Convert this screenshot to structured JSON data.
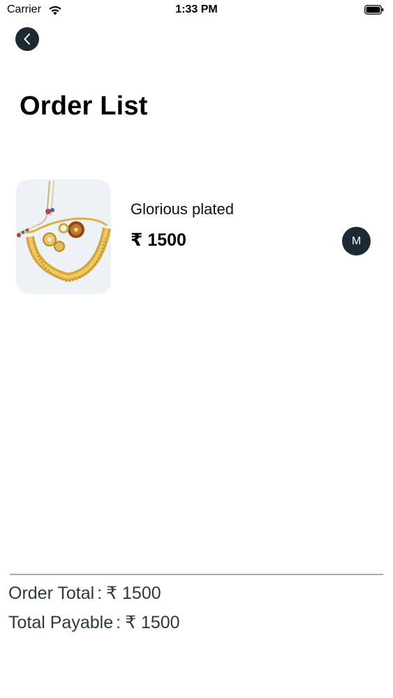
{
  "status_bar": {
    "carrier": "Carrier",
    "time": "1:33 PM",
    "icons": [
      "wifi-icon",
      "battery-icon"
    ]
  },
  "header": {
    "back_icon": "chevron-left-icon",
    "title": "Order List"
  },
  "orders": [
    {
      "name": "Glorious plated",
      "price": "₹ 1500",
      "avatar_initial": "M",
      "image": "gold-necklace-set"
    }
  ],
  "totals": {
    "order_total_label": "Order Total",
    "order_total_value": "₹ 1500",
    "payable_label": "Total Payable",
    "payable_value": "₹ 1500",
    "separator": ":"
  },
  "colors": {
    "dark_button": "#1c2b33",
    "total_text": "#2c3a40",
    "thumb_bg": "#eef2f6",
    "divider": "#a8a8a8"
  }
}
